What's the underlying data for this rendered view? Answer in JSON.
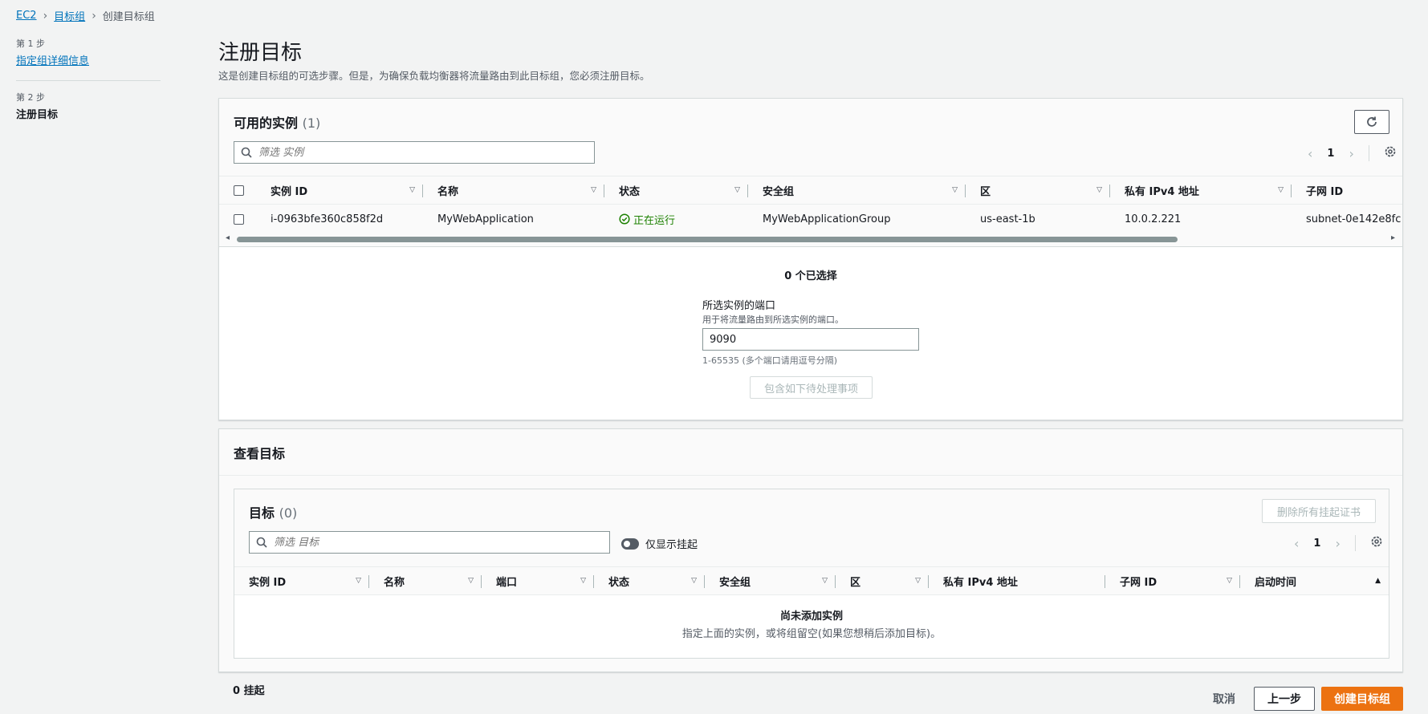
{
  "breadcrumb": {
    "ec2": "EC2",
    "target_groups": "目标组",
    "current": "创建目标组"
  },
  "steps": {
    "step1_label": "第 1 步",
    "step1_link": "指定组详细信息",
    "step2_label": "第 2 步",
    "step2_current": "注册目标"
  },
  "page": {
    "title": "注册目标",
    "subtitle": "这是创建目标组的可选步骤。但是，为确保负载均衡器将流量路由到此目标组，您必须注册目标。"
  },
  "available": {
    "title": "可用的实例",
    "count": "(1)",
    "search_placeholder": "筛选 实例",
    "page": "1",
    "columns": [
      "实例 ID",
      "名称",
      "状态",
      "安全组",
      "区",
      "私有 IPv4 地址",
      "子网 ID"
    ],
    "rows": [
      {
        "instance_id": "i-0963bfe360c858f2d",
        "name": "MyWebApplication",
        "status": "正在运行",
        "security_group": "MyWebApplicationGroup",
        "zone": "us-east-1b",
        "private_ip": "10.0.2.221",
        "subnet": "subnet-0e142e8fc"
      }
    ],
    "selected_text": "0 个已选择",
    "port_label": "所选实例的端口",
    "port_desc": "用于将流量路由到所选实例的端口。",
    "port_value": "9090",
    "port_hint": "1-65535 (多个端口请用逗号分隔)",
    "include_button": "包含如下待处理事项"
  },
  "review": {
    "title": "查看目标",
    "targets_title": "目标",
    "targets_count": "(0)",
    "remove_all_button": "删除所有挂起证书",
    "search_placeholder": "筛选 目标",
    "toggle_label": "仅显示挂起",
    "page": "1",
    "columns": [
      "实例 ID",
      "名称",
      "端口",
      "状态",
      "安全组",
      "区",
      "私有 IPv4 地址",
      "子网 ID",
      "启动时间"
    ],
    "empty_title": "尚未添加实例",
    "empty_desc": "指定上面的实例，或将组留空(如果您想稍后添加目标)。"
  },
  "footer": {
    "pending": "0 挂起",
    "cancel": "取消",
    "previous": "上一步",
    "create": "创建目标组"
  },
  "colors": {
    "accent": "#0073bb",
    "primary_button": "#ec7211",
    "success": "#1d8102"
  }
}
